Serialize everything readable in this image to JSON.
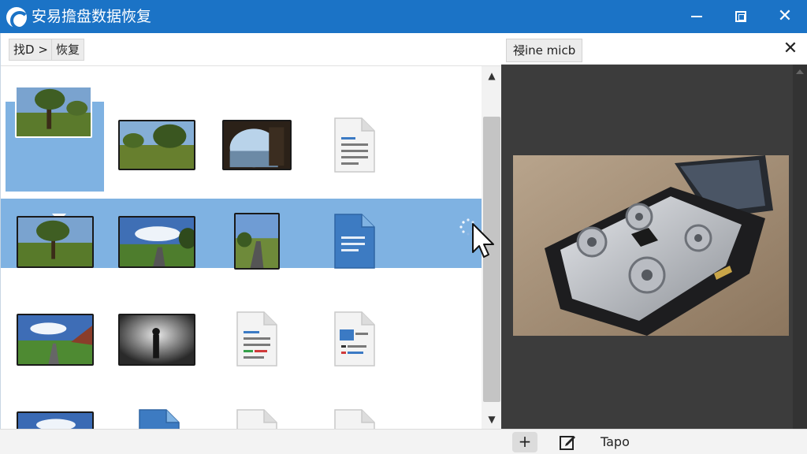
{
  "window": {
    "title": "安易擔盘数据恢复",
    "logo_icon": "app-logo-icon",
    "minimize_icon": "minimize-icon",
    "maximize_icon": "maximize-icon",
    "close_icon": "close-icon",
    "accent_color": "#1b73c6"
  },
  "breadcrumb": {
    "items": [
      {
        "label": "找D >"
      },
      {
        "label": "恢复"
      }
    ]
  },
  "file_grid": {
    "rows": [
      [
        {
          "type": "image",
          "icon": "landscape-thumbnail",
          "selected": true
        },
        {
          "type": "image",
          "icon": "landscape-thumbnail"
        },
        {
          "type": "image",
          "icon": "landscape-thumbnail"
        },
        {
          "type": "document",
          "icon": "document-icon"
        }
      ],
      [
        {
          "type": "image",
          "icon": "landscape-thumbnail"
        },
        {
          "type": "image",
          "icon": "landscape-thumbnail"
        },
        {
          "type": "image",
          "icon": "landscape-thumbnail"
        },
        {
          "type": "document",
          "icon": "document-icon"
        }
      ],
      [
        {
          "type": "image",
          "icon": "landscape-thumbnail"
        },
        {
          "type": "image",
          "icon": "landscape-thumbnail"
        },
        {
          "type": "document",
          "icon": "document-icon"
        },
        {
          "type": "document",
          "icon": "document-icon"
        }
      ],
      [
        {
          "type": "image",
          "icon": "landscape-thumbnail"
        },
        {
          "type": "document",
          "icon": "document-icon"
        },
        {
          "type": "document",
          "icon": "document-icon"
        },
        {
          "type": "document",
          "icon": "document-icon"
        }
      ]
    ],
    "highlight_color": "#7fb2e2"
  },
  "scrollbar": {
    "up_icon": "scroll-up-icon",
    "down_icon": "scroll-down-icon"
  },
  "preview": {
    "tab_label": "祲ine micb",
    "close_icon": "close-icon",
    "image_icon": "hard-drive-photo"
  },
  "bottom_bar": {
    "add_label": "+",
    "edit_icon": "edit-icon",
    "label": "Tapo"
  }
}
